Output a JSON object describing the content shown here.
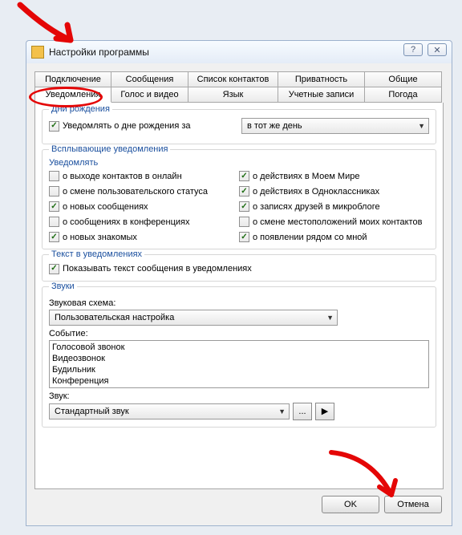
{
  "window": {
    "title": "Настройки программы"
  },
  "tabs_row1": {
    "t1": "Подключение",
    "t2": "Сообщения",
    "t3": "Список контактов",
    "t4": "Приватность",
    "t5": "Общие"
  },
  "tabs_row2": {
    "t6": "Уведомления",
    "t7": "Голос и видео",
    "t8": "Язык",
    "t9": "Учетные записи",
    "t10": "Погода"
  },
  "birthdays": {
    "legend": "Дни рождения",
    "chk_label": "Уведомлять о дне рождения за",
    "select_value": "в тот же день"
  },
  "popups": {
    "legend": "Всплывающие уведомления",
    "subtitle": "Уведомлять",
    "left": {
      "c1": "о выходе контактов в онлайн",
      "c2": "о смене пользовательского статуса",
      "c3": "о новых сообщениях",
      "c4": "о сообщениях в конференциях",
      "c5": "о новых знакомых"
    },
    "right": {
      "c1": "о действиях в Моем Мире",
      "c2": "о действиях в Одноклассниках",
      "c3": "о записях друзей в микроблоге",
      "c4": "о смене местоположений моих контактов",
      "c5": "о появлении рядом со мной"
    }
  },
  "notif_text": {
    "legend": "Текст в уведомлениях",
    "chk_label": "Показывать текст сообщения в уведомлениях"
  },
  "sounds": {
    "legend": "Звуки",
    "scheme_label": "Звуковая схема:",
    "scheme_value": "Пользовательская настройка",
    "event_label": "Событие:",
    "events": {
      "e1": "Голосовой звонок",
      "e2": "Видеозвонок",
      "e3": "Будильник",
      "e4": "Конференция"
    },
    "sound_label": "Звук:",
    "sound_value": "Стандартный звук",
    "browse": "...",
    "play": "▶"
  },
  "buttons": {
    "help": "?",
    "close": "✕",
    "ok": "OK",
    "cancel": "Отмена"
  }
}
